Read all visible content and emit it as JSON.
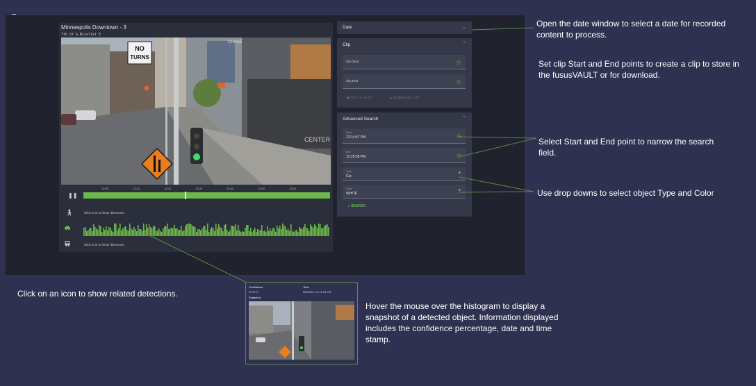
{
  "camera": {
    "title": "Minneapolis Downtown - 3",
    "subtitle": "7th St & Nicollet E"
  },
  "video_signs": {
    "no_turns_1": "NO",
    "no_turns_2": "TURNS",
    "chase": "CHASE",
    "center": "CENTER"
  },
  "timeline": {
    "ticks": [
      "12:00",
      "12:10",
      "12:20",
      "12:30",
      "12:40",
      "12:50",
      "13:00"
    ],
    "play_state_icon": "pause-icon",
    "marker_position": 0.41
  },
  "detections": {
    "hint_top": "Click icon to show detections",
    "hint_bottom": "Click icon to show detections",
    "icons": [
      "person-icon",
      "car-icon",
      "bus-icon"
    ],
    "histogram_color": "#6cb84a",
    "cursor_color": "#e23b2e"
  },
  "date_section": {
    "title": "Date"
  },
  "clip_section": {
    "title": "Clip",
    "start_label": "Clip Start",
    "end_label": "Clip End",
    "add_to_vault": "ADD TO VAULT",
    "download_clip": "DOWNLOAD CLIP"
  },
  "advanced_search": {
    "title": "Advanced Search",
    "start_small": "Start",
    "start_value": "12:14:57 PM",
    "end_small": "End",
    "end_value": "12:29:58 PM",
    "type_small": "Type",
    "type_value": "Car",
    "color_small": "Color",
    "color_value": "WHITE",
    "search_button": "SEARCH"
  },
  "annotations": {
    "date_note": "Open the date window to select a date for recorded content to process.",
    "clip_note": "Set clip Start and End points to create a clip to store in the fususVAULT or for download.",
    "search_note": "Select Start and End point to narrow the search field.",
    "dropdown_note": "Use drop downs to select object Type and Color",
    "icon_note": "Click on an icon to show related detections.",
    "histogram_note": "Hover the mouse over the histogram to display a snapshot of a detected object.  Information displayed includes the confidence percentage, date and time stamp."
  },
  "popup": {
    "confidence_label": "Confidence",
    "confidence_value": "92.97%",
    "time_label": "Time",
    "time_value": "6/8/2020, 12:21:04 PM",
    "snapshot_label": "Snapshot"
  },
  "colors": {
    "page_bg": "#2e3150",
    "app_bg": "#20222e",
    "panel_bg": "#2b2e3b",
    "card_bg": "#353848",
    "accent_green": "#6cb84a",
    "connector_green": "#5d8b4a"
  }
}
